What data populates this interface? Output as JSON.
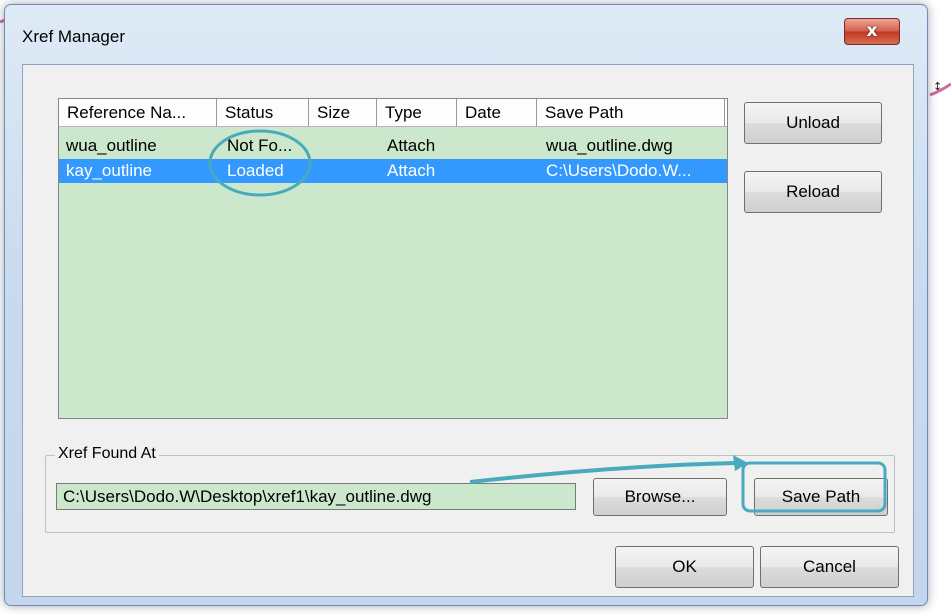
{
  "window": {
    "title": "Xref Manager",
    "close_glyph": "x"
  },
  "references": {
    "columns": [
      "Reference Na...",
      "Status",
      "Size",
      "Type",
      "Date",
      "Save Path"
    ],
    "rows": [
      {
        "name": "wua_outline",
        "status": "Not Fo...",
        "size": "",
        "type": "Attach",
        "date": "",
        "save_path": "wua_outline.dwg",
        "selected": false
      },
      {
        "name": "kay_outline",
        "status": "Loaded",
        "size": "",
        "type": "Attach",
        "date": "",
        "save_path": "C:\\Users\\Dodo.W...",
        "selected": true
      }
    ]
  },
  "side_buttons": {
    "unload": "Unload",
    "reload": "Reload"
  },
  "found_at": {
    "label": "Xref Found At",
    "path": "C:\\Users\\Dodo.W\\Desktop\\xref1\\kay_outline.dwg",
    "browse": "Browse...",
    "save_path": "Save Path"
  },
  "footer": {
    "ok": "OK",
    "cancel": "Cancel"
  },
  "colors": {
    "list_background": "#cce8cc",
    "selection": "#3399ff",
    "annotation": "#4aaabd"
  }
}
